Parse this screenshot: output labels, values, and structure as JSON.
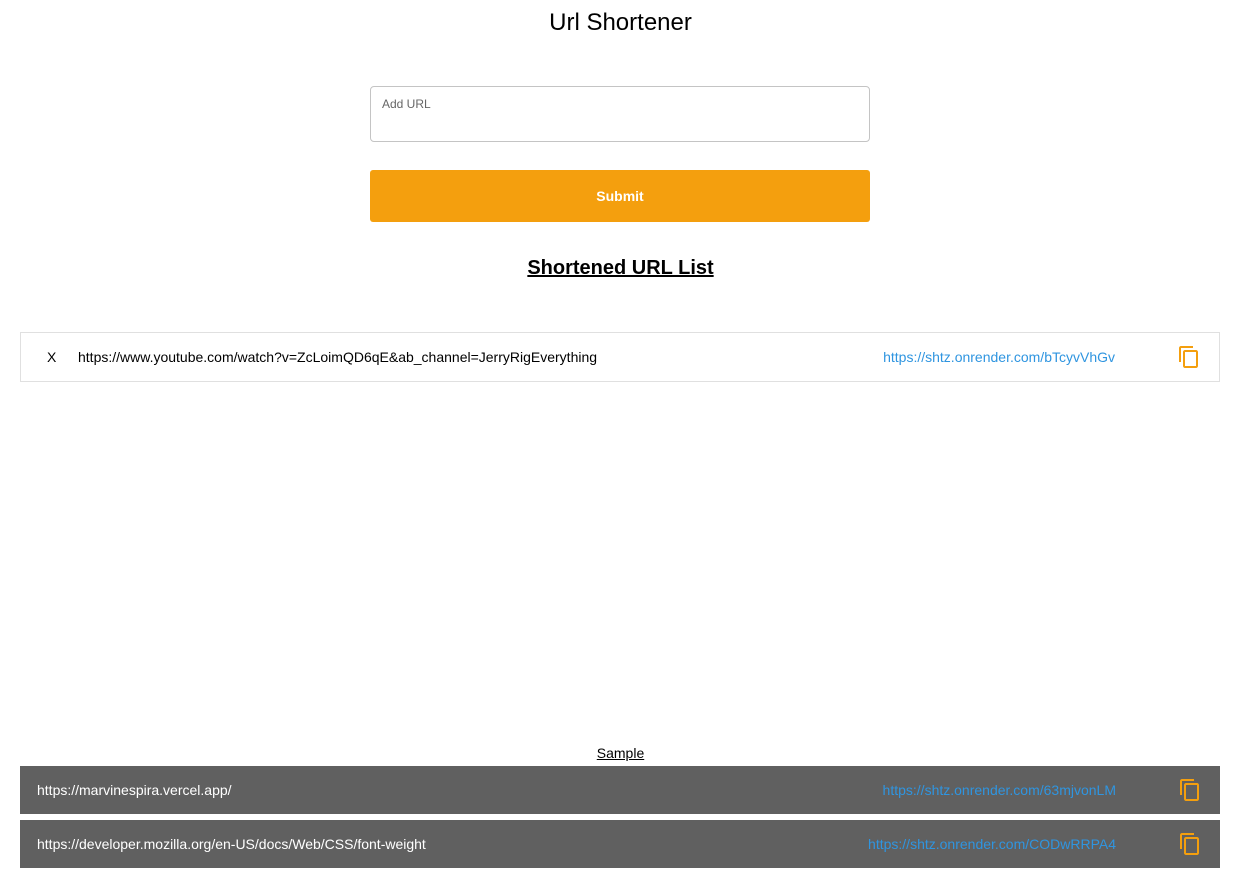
{
  "app": {
    "title": "Url Shortener"
  },
  "form": {
    "url_label": "Add URL",
    "url_value": "",
    "submit_label": "Submit"
  },
  "list": {
    "heading": "Shortened URL List",
    "delete_label": "X",
    "items": [
      {
        "original": "https://www.youtube.com/watch?v=ZcLoimQD6qE&ab_channel=JerryRigEverything",
        "short": "https://shtz.onrender.com/bTcyvVhGv"
      }
    ]
  },
  "samples": {
    "label": "Sample",
    "items": [
      {
        "original": "https://marvinespira.vercel.app/",
        "short": "https://shtz.onrender.com/63mjvonLM"
      },
      {
        "original": "https://developer.mozilla.org/en-US/docs/Web/CSS/font-weight",
        "short": "https://shtz.onrender.com/CODwRRPA4"
      }
    ]
  },
  "colors": {
    "accent": "#f49f0e",
    "link": "#2f95e0",
    "sample_row_bg": "#606060"
  },
  "icons": {
    "copy": "copy-icon"
  }
}
